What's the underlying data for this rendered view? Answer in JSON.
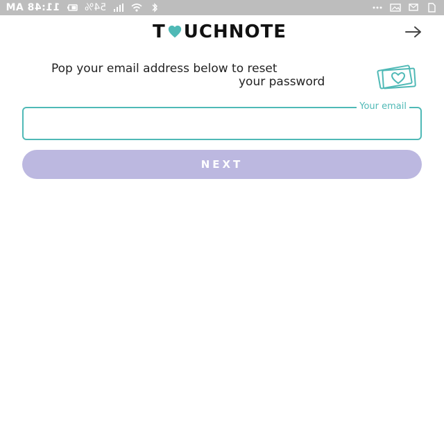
{
  "status_bar": {
    "time": "11:48 AM",
    "battery": "54%",
    "icons": [
      "bluetooth-icon",
      "wifi-icon",
      "signal-icon",
      "battery-icon",
      "sim-icon",
      "message-icon",
      "image-icon",
      "more-dots-icon"
    ]
  },
  "header": {
    "logo_part1": "T",
    "logo_part2": "UCHNOTE",
    "logo_heart_icon": "heart-icon",
    "nav_icon": "arrow-right-icon"
  },
  "instruction": {
    "text_line1": "Pop your email address below to reset",
    "text_line2": "your password",
    "icon": "card-heart-icon"
  },
  "form": {
    "email_label": "Your email",
    "email_value": "",
    "next_button_label": "NEXT"
  },
  "colors": {
    "accent_teal": "#4fb9b6",
    "button_lavender": "#bcb8e0",
    "status_bar": "#bdbdbd"
  }
}
